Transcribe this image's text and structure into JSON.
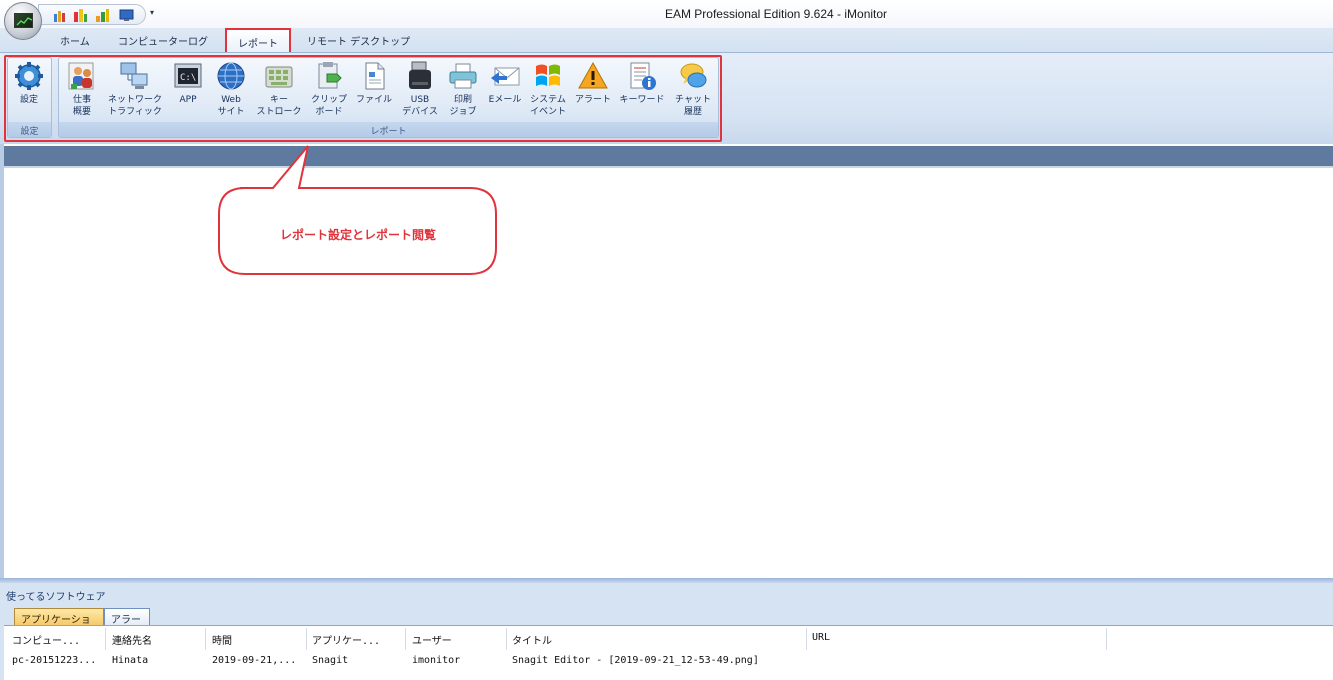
{
  "window": {
    "title": "EAM Professional Edition 9.624 - iMonitor"
  },
  "quick_access": {
    "icons": [
      "bar-chart-icon",
      "grouped-bar-icon",
      "stacked-bar-icon",
      "monitor-icon"
    ],
    "dropdown": "▾"
  },
  "tabs": [
    {
      "label": "ホーム"
    },
    {
      "label": "コンピューターログ"
    },
    {
      "label": "レポート",
      "active": true
    },
    {
      "label": "リモート デスクトップ"
    }
  ],
  "ribbon": {
    "settings_group": {
      "label": "設定",
      "buttons": [
        {
          "label": "設定",
          "icon": "gear-icon"
        }
      ]
    },
    "report_group": {
      "label": "レポート",
      "buttons": [
        {
          "label": "仕事\n概要",
          "icon": "people-icon"
        },
        {
          "label": "ネットワーク\nトラフィック",
          "icon": "network-computers-icon"
        },
        {
          "label": "APP",
          "icon": "console-icon"
        },
        {
          "label": "Web\nサイト",
          "icon": "globe-icon"
        },
        {
          "label": "キー\nストローク",
          "icon": "keyboard-icon"
        },
        {
          "label": "クリップ\nボード",
          "icon": "clipboard-icon"
        },
        {
          "label": "ファイル",
          "icon": "file-icon"
        },
        {
          "label": "USB\nデバイス",
          "icon": "usb-drive-icon"
        },
        {
          "label": "印刷\nジョブ",
          "icon": "printer-icon"
        },
        {
          "label": "Eメール",
          "icon": "envelope-icon"
        },
        {
          "label": "システム\nイベント",
          "icon": "windows-logo-icon"
        },
        {
          "label": "アラート",
          "icon": "warning-icon"
        },
        {
          "label": "キーワード",
          "icon": "document-info-icon"
        },
        {
          "label": "チャット\n履歴",
          "icon": "chat-bubble-icon"
        }
      ]
    }
  },
  "callout": {
    "text": "レポート設定とレポート閲覧"
  },
  "bottom_panel": {
    "title": "使ってるソフトウェア",
    "tabs": [
      {
        "label": "アプリケーション",
        "active": true
      },
      {
        "label": "アラート"
      }
    ],
    "table": {
      "columns": [
        "コンピュー...",
        "連絡先名",
        "時間",
        "アプリケー...",
        "ユーザー",
        "タイトル",
        "URL"
      ],
      "rows": [
        [
          "pc-20151223...",
          "Hinata",
          "2019-09-21,...",
          "Snagit",
          "imonitor",
          "Snagit Editor - [2019-09-21_12-53-49.png]",
          ""
        ]
      ]
    }
  },
  "colors": {
    "highlight": "#e0333c",
    "band": "#5e7a9e",
    "ribbon": "#dce7f4"
  }
}
